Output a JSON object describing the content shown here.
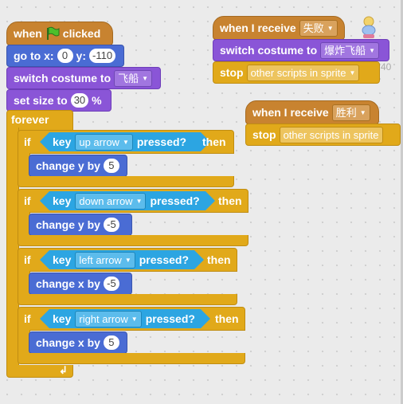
{
  "script_main": {
    "hat_prefix": "when",
    "hat_suffix": "clicked",
    "goto_label": "go to x:",
    "goto_x": "0",
    "goto_y_label": "y:",
    "goto_y": "-110",
    "costume_label": "switch costume to",
    "costume_value": "飞船",
    "size_label": "set size to",
    "size_value": "30",
    "size_unit": "%",
    "forever_label": "forever",
    "ifs": [
      {
        "if": "if",
        "key": "key",
        "key_value": "up arrow",
        "pressed": "pressed?",
        "then": "then",
        "action": "change y by",
        "action_value": "5"
      },
      {
        "if": "if",
        "key": "key",
        "key_value": "down arrow",
        "pressed": "pressed?",
        "then": "then",
        "action": "change y by",
        "action_value": "-5"
      },
      {
        "if": "if",
        "key": "key",
        "key_value": "left arrow",
        "pressed": "pressed?",
        "then": "then",
        "action": "change x by",
        "action_value": "-5"
      },
      {
        "if": "if",
        "key": "key",
        "key_value": "right arrow",
        "pressed": "pressed?",
        "then": "then",
        "action": "change x by",
        "action_value": "5"
      }
    ]
  },
  "script_fail": {
    "hat_label": "when I receive",
    "hat_value": "失败",
    "costume_label": "switch costume to",
    "costume_value": "爆炸飞船",
    "stop_label": "stop",
    "stop_value": "other scripts in sprite",
    "faint_number": "40"
  },
  "script_win": {
    "hat_label": "when I receive",
    "hat_value": "胜利",
    "stop_label": "stop",
    "stop_value": "other scripts in sprite"
  },
  "icons": {
    "flag": "green-flag-icon",
    "sprite": "sprite-thumbnail",
    "loop": "loop-arrow-icon"
  }
}
